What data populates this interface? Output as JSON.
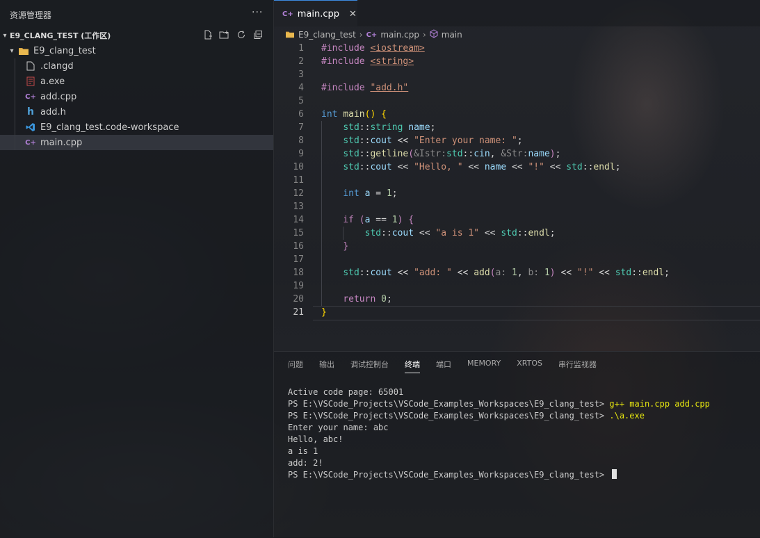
{
  "sidebar": {
    "title": "资源管理器",
    "more": "···",
    "workspace_label": "E9_CLANG_TEST (工作区)",
    "folder": "E9_clang_test",
    "files": [
      {
        "name": ".clangd",
        "icon": "file-icon"
      },
      {
        "name": "a.exe",
        "icon": "exe-icon"
      },
      {
        "name": "add.cpp",
        "icon": "cpp-icon"
      },
      {
        "name": "add.h",
        "icon": "header-icon"
      },
      {
        "name": "E9_clang_test.code-workspace",
        "icon": "vscode-icon"
      },
      {
        "name": "main.cpp",
        "icon": "cpp-icon",
        "selected": true
      }
    ]
  },
  "editor": {
    "tab_label": "main.cpp",
    "tab_icon": "C++",
    "breadcrumb": [
      "E9_clang_test",
      "main.cpp",
      "main"
    ],
    "current_line": 21,
    "line_numbers": [
      "1",
      "2",
      "3",
      "4",
      "5",
      "6",
      "7",
      "8",
      "9",
      "10",
      "11",
      "12",
      "13",
      "14",
      "15",
      "16",
      "17",
      "18",
      "19",
      "20",
      "21"
    ]
  },
  "panel": {
    "tabs": [
      "问题",
      "输出",
      "调试控制台",
      "终端",
      "端口",
      "MEMORY",
      "XRTOS",
      "串行监视器"
    ],
    "active_tab": "终端",
    "terminal": {
      "line1": "Active code page: 65001",
      "prompt": "PS E:\\VSCode_Projects\\VSCode_Examples_Workspaces\\E9_clang_test> ",
      "cmd1": "g++ main.cpp add.cpp",
      "cmd2": ".\\a.exe",
      "out1": "Enter your name: abc",
      "out2": "Hello, abc!",
      "out3": "a is 1",
      "out4": "add: 2!"
    }
  },
  "colors": {
    "accent": "#3c8ae0",
    "keyword": "#569cd6",
    "string": "#ce9178",
    "function": "#dcdcaa",
    "namespace": "#4ec9b0",
    "variable": "#9cdcfe",
    "preprocessor": "#c586c0"
  }
}
